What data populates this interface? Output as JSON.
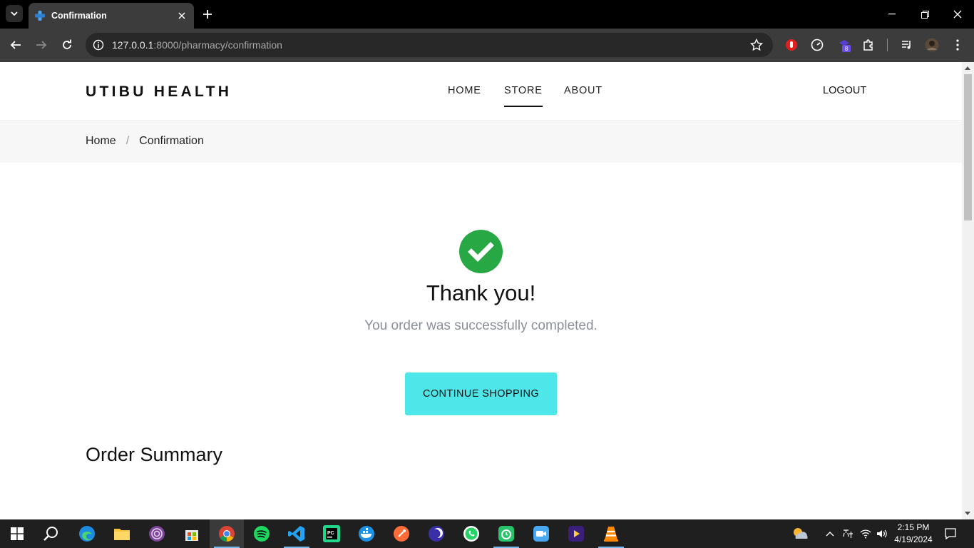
{
  "browser": {
    "tab_title": "Confirmation",
    "url_host": "127.0.0.1",
    "url_path": ":8000/pharmacy/confirmation"
  },
  "site": {
    "brand": "UTIBU HEALTH",
    "nav": [
      "HOME",
      "STORE",
      "ABOUT"
    ],
    "active_nav": "STORE",
    "logout": "LOGOUT"
  },
  "breadcrumb": {
    "home": "Home",
    "separator": "/",
    "current": "Confirmation"
  },
  "confirmation": {
    "heading": "Thank you!",
    "message": "You order was successfully completed.",
    "button": "CONTINUE SHOPPING",
    "summary_title": "Order Summary"
  },
  "taskbar": {
    "time": "2:15 PM",
    "date": "4/19/2024",
    "extension_badge": "8"
  },
  "colors": {
    "success": "#28a745",
    "accent_button": "#4fe6ea"
  }
}
